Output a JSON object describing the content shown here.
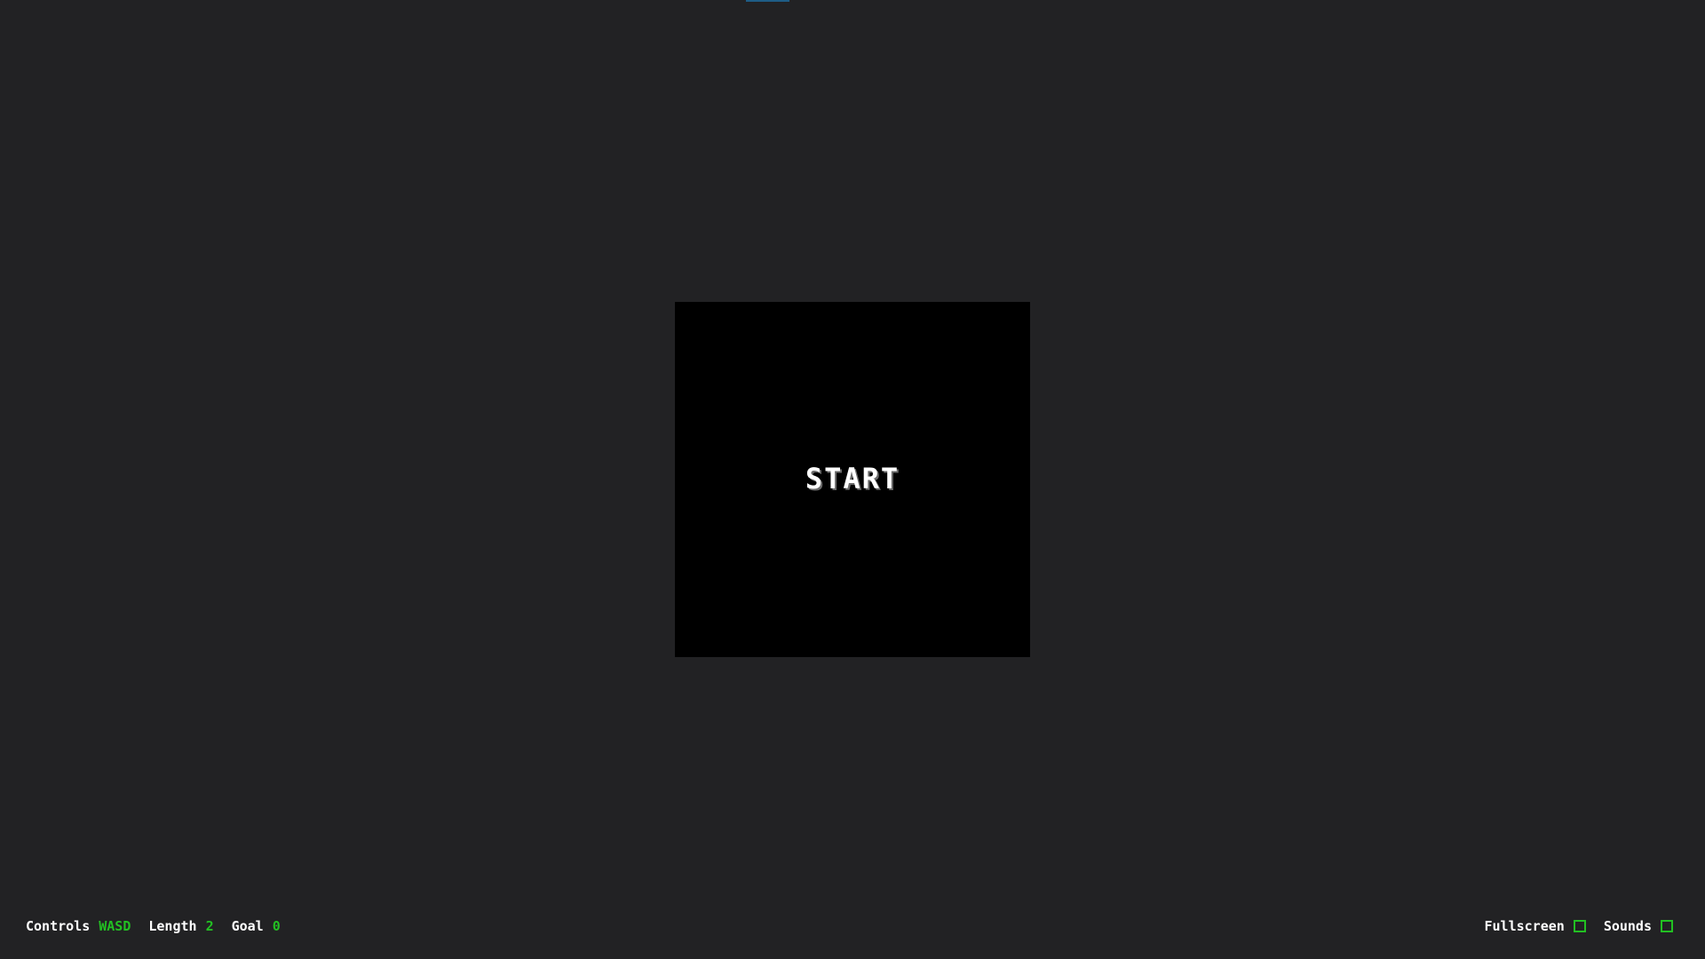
{
  "game": {
    "start_label": "START"
  },
  "hud": {
    "controls": {
      "label": "Controls",
      "value": "WASD"
    },
    "length": {
      "label": "Length",
      "value": "2"
    },
    "goal": {
      "label": "Goal",
      "value": "0"
    },
    "fullscreen": {
      "label": "Fullscreen",
      "checked": false
    },
    "sounds": {
      "label": "Sounds",
      "checked": false
    }
  },
  "colors": {
    "background": "#222224",
    "board": "#000000",
    "accent": "#22c022",
    "text": "#ffffff",
    "top_indicator": "#1e5d86"
  }
}
